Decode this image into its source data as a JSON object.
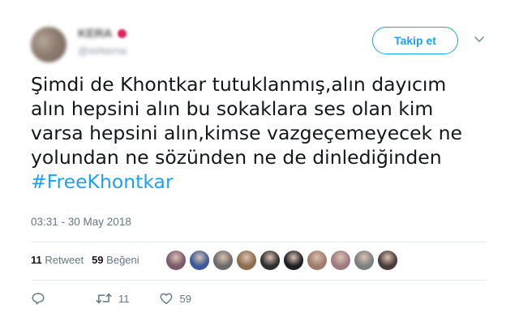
{
  "user": {
    "name": "KERA",
    "handle": "@eirkerna"
  },
  "follow_button": {
    "label": "Takip et"
  },
  "tweet": {
    "lines": [
      "Şimdi de Khontkar tutuklanmış,alın dayıcım",
      "alın hepsini alın bu sokaklara ses olan kim",
      "varsa hepsini alın,kimse vazgeçemeyecek ne",
      "yolundan ne sözünden ne de dinlediğinden"
    ],
    "hashtag": "#FreeKhontkar",
    "timestamp": "03:31 - 30 May 2018"
  },
  "stats": {
    "retweet_count": "11",
    "retweet_label": "Retweet",
    "like_count": "59",
    "like_label": "Beğeni"
  },
  "liker_avatars": [
    {
      "color": "#7a5a6b"
    },
    {
      "color": "#3b5998"
    },
    {
      "color": "#6b6b6b"
    },
    {
      "color": "#8c6d4f"
    },
    {
      "color": "#2f2f2f"
    },
    {
      "color": "#1e1e24"
    },
    {
      "color": "#a07a6a"
    },
    {
      "color": "#9e7b83"
    },
    {
      "color": "#7b7f80"
    },
    {
      "color": "#4a3c3c"
    }
  ],
  "actions": {
    "reply_icon": "reply-icon",
    "retweet_icon": "retweet-icon",
    "retweet_count": "11",
    "like_icon": "heart-icon",
    "like_count": "59"
  },
  "colors": {
    "accent": "#1da1f2",
    "secondary_text": "#657786",
    "divider": "#e6ecf0"
  }
}
